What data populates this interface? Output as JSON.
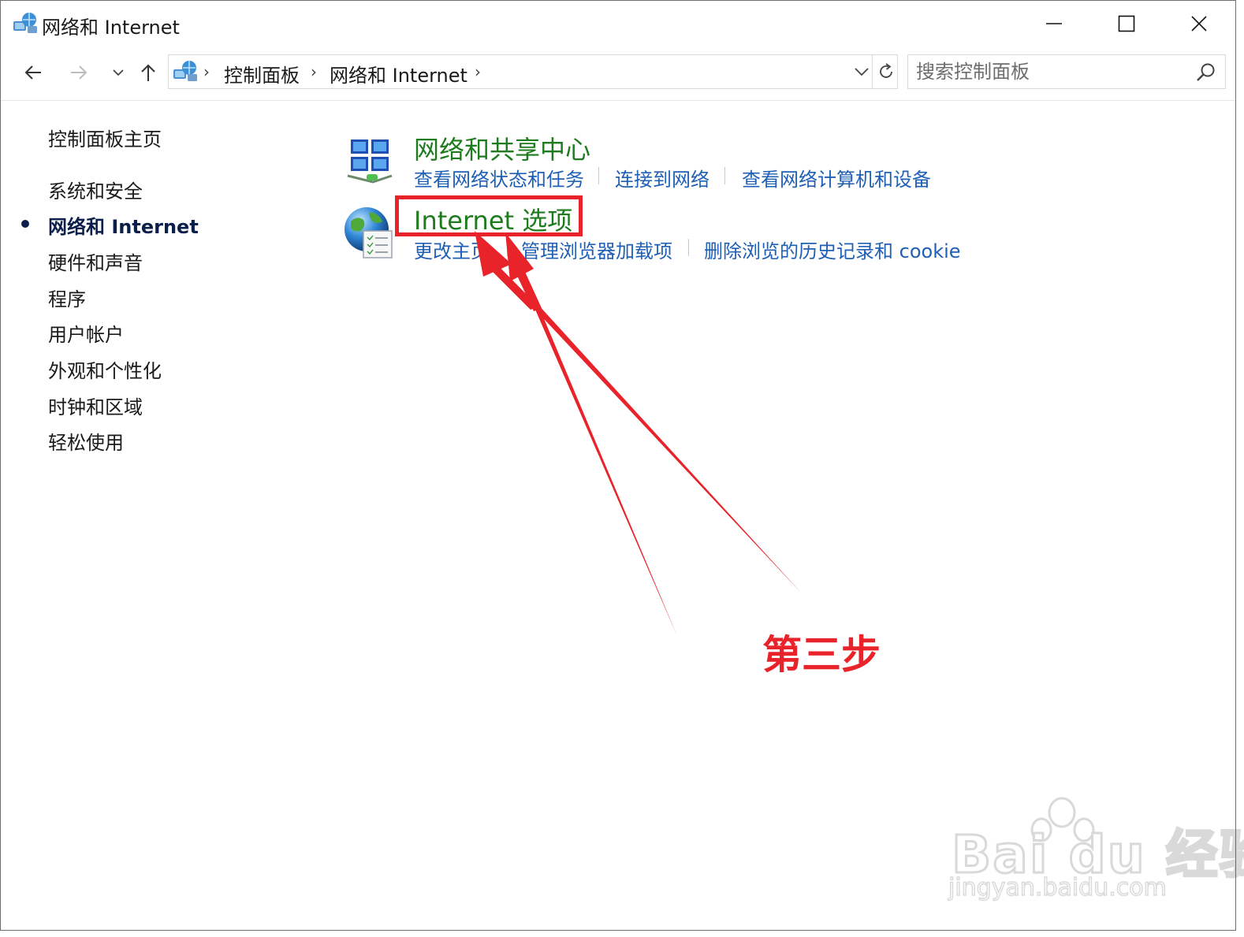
{
  "window": {
    "title": "网络和 Internet",
    "icon": "control-panel-network-icon"
  },
  "navigation": {
    "back_icon": "back-arrow-icon",
    "forward_icon": "forward-arrow-icon",
    "recent_icon": "chevron-down-icon",
    "up_icon": "up-arrow-icon",
    "breadcrumb": [
      "控制面板",
      "网络和 Internet"
    ],
    "refresh_icon": "refresh-icon"
  },
  "search": {
    "placeholder": "搜索控制面板",
    "icon": "search-icon"
  },
  "sidebar": {
    "home": "控制面板主页",
    "items": [
      {
        "label": "系统和安全",
        "active": false
      },
      {
        "label": "网络和 Internet",
        "active": true
      },
      {
        "label": "硬件和声音",
        "active": false
      },
      {
        "label": "程序",
        "active": false
      },
      {
        "label": "用户帐户",
        "active": false
      },
      {
        "label": "外观和个性化",
        "active": false
      },
      {
        "label": "时钟和区域",
        "active": false
      },
      {
        "label": "轻松使用",
        "active": false
      }
    ]
  },
  "categories": [
    {
      "title": "网络和共享中心",
      "icon": "network-sharing-center-icon",
      "tasks": [
        "查看网络状态和任务",
        "连接到网络",
        "查看网络计算机和设备"
      ]
    },
    {
      "title": "Internet 选项",
      "icon": "internet-options-globe-icon",
      "tasks": [
        "更改主页",
        "管理浏览器加载项",
        "删除浏览的历史记录和 cookie"
      ]
    }
  ],
  "annotation": {
    "text": "第三步",
    "color": "#e8232a"
  },
  "watermark": {
    "brand": "Bai du 经验",
    "url": "jingyan.baidu.com"
  },
  "colors": {
    "category_title": "#1e7b1e",
    "task_link": "#1f5fb4",
    "active_sidebar": "#0c1f4a"
  }
}
